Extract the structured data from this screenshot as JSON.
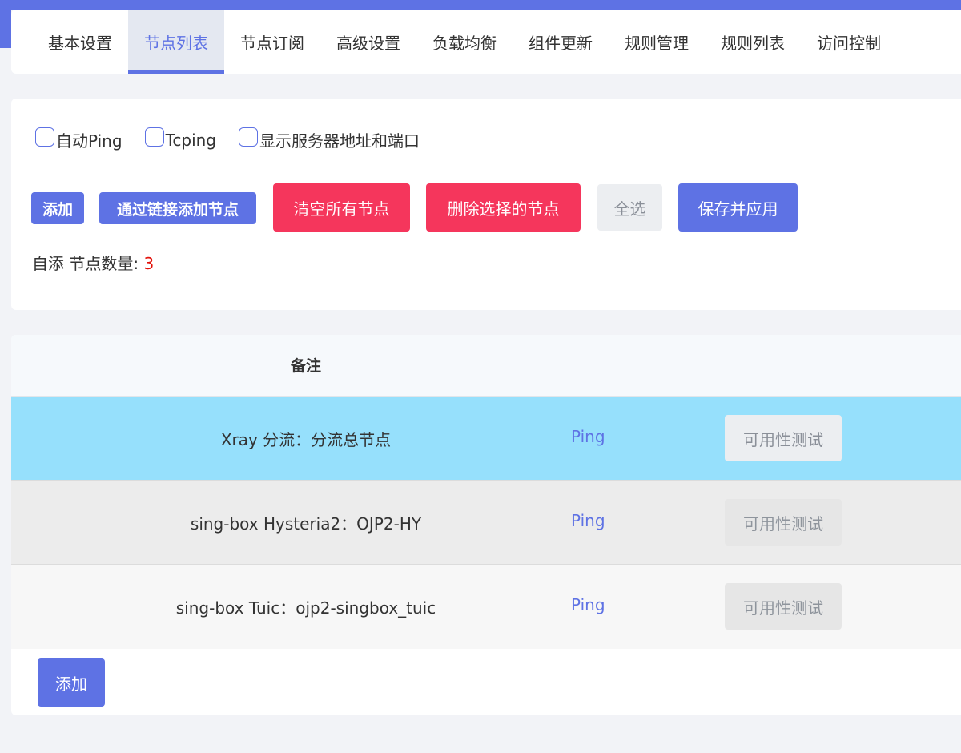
{
  "tabs": [
    {
      "label": "基本设置",
      "active": false
    },
    {
      "label": "节点列表",
      "active": true
    },
    {
      "label": "节点订阅",
      "active": false
    },
    {
      "label": "高级设置",
      "active": false
    },
    {
      "label": "负载均衡",
      "active": false
    },
    {
      "label": "组件更新",
      "active": false
    },
    {
      "label": "规则管理",
      "active": false
    },
    {
      "label": "规则列表",
      "active": false
    },
    {
      "label": "访问控制",
      "active": false
    }
  ],
  "options": {
    "auto_ping": {
      "label": "自动Ping",
      "checked": false
    },
    "tcping": {
      "label": "Tcping",
      "checked": false
    },
    "show_server": {
      "label": "显示服务器地址和端口",
      "checked": false
    }
  },
  "actions": {
    "add": "添加",
    "add_by_link": "通过链接添加节点",
    "clear_all": "清空所有节点",
    "delete_selected": "删除选择的节点",
    "select_all": "全选",
    "save_apply": "保存并应用"
  },
  "node_count": {
    "label": "自添 节点数量: ",
    "value": "3"
  },
  "table": {
    "header_remark": "备注",
    "rows": [
      {
        "remark": "Xray 分流：分流总节点",
        "ping": "Ping",
        "test": "可用性测试"
      },
      {
        "remark": "sing-box Hysteria2：OJP2-HY",
        "ping": "Ping",
        "test": "可用性测试"
      },
      {
        "remark": "sing-box Tuic：ojp2-singbox_tuic",
        "ping": "Ping",
        "test": "可用性测试"
      }
    ],
    "add_button": "添加"
  },
  "colors": {
    "primary": "#5e72e4",
    "danger": "#f5365c",
    "highlight_row": "#96e0fc",
    "count_red": "#e3120b"
  }
}
